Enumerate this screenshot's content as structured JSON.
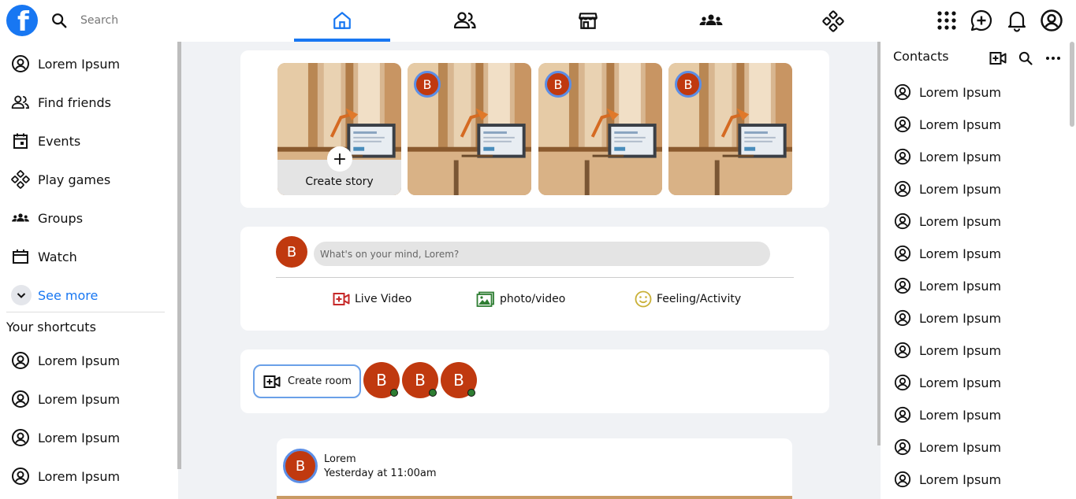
{
  "header": {
    "logo_letter": "f",
    "search_placeholder": "Search"
  },
  "left_sidebar": {
    "items": [
      {
        "label": "Lorem Ipsum",
        "icon": "user-circle-icon"
      },
      {
        "label": "Find friends",
        "icon": "friends-icon"
      },
      {
        "label": "Events",
        "icon": "calendar-icon"
      },
      {
        "label": "Play games",
        "icon": "gamepad-icon"
      },
      {
        "label": "Groups",
        "icon": "groups-icon"
      },
      {
        "label": "Watch",
        "icon": "video-icon"
      }
    ],
    "see_more": "See more",
    "shortcuts_title": "Your shortcuts",
    "shortcuts": [
      "Lorem Ipsum",
      "Lorem Ipsum",
      "Lorem Ipsum",
      "Lorem Ipsum"
    ]
  },
  "stories": {
    "create_label": "Create story",
    "create_icon": "+",
    "avatar_letter": "B"
  },
  "composer": {
    "avatar_letter": "B",
    "placeholder": "What's on your mind, Lorem?",
    "actions": [
      {
        "label": "Live Video",
        "icon": "live-video-icon",
        "color": "#c62828"
      },
      {
        "label": "photo/video",
        "icon": "photo-icon",
        "color": "#2e7d32"
      },
      {
        "label": "Feeling/Activity",
        "icon": "smiley-icon",
        "color": "#c9b037"
      }
    ]
  },
  "rooms": {
    "create_label": "Create room",
    "avatar_letter": "B"
  },
  "post": {
    "avatar_letter": "B",
    "author": "Lorem",
    "time": "Yesterday at 11:00am"
  },
  "contacts": {
    "title": "Contacts",
    "items": [
      "Lorem Ipsum",
      "Lorem Ipsum",
      "Lorem Ipsum",
      "Lorem Ipsum",
      "Lorem Ipsum",
      "Lorem Ipsum",
      "Lorem Ipsum",
      "Lorem Ipsum",
      "Lorem Ipsum",
      "Lorem Ipsum",
      "Lorem Ipsum",
      "Lorem Ipsum",
      "Lorem Ipsum"
    ]
  },
  "colors": {
    "brand": "#1877f2",
    "avatar": "#c0390f",
    "online": "#2e7d32"
  }
}
